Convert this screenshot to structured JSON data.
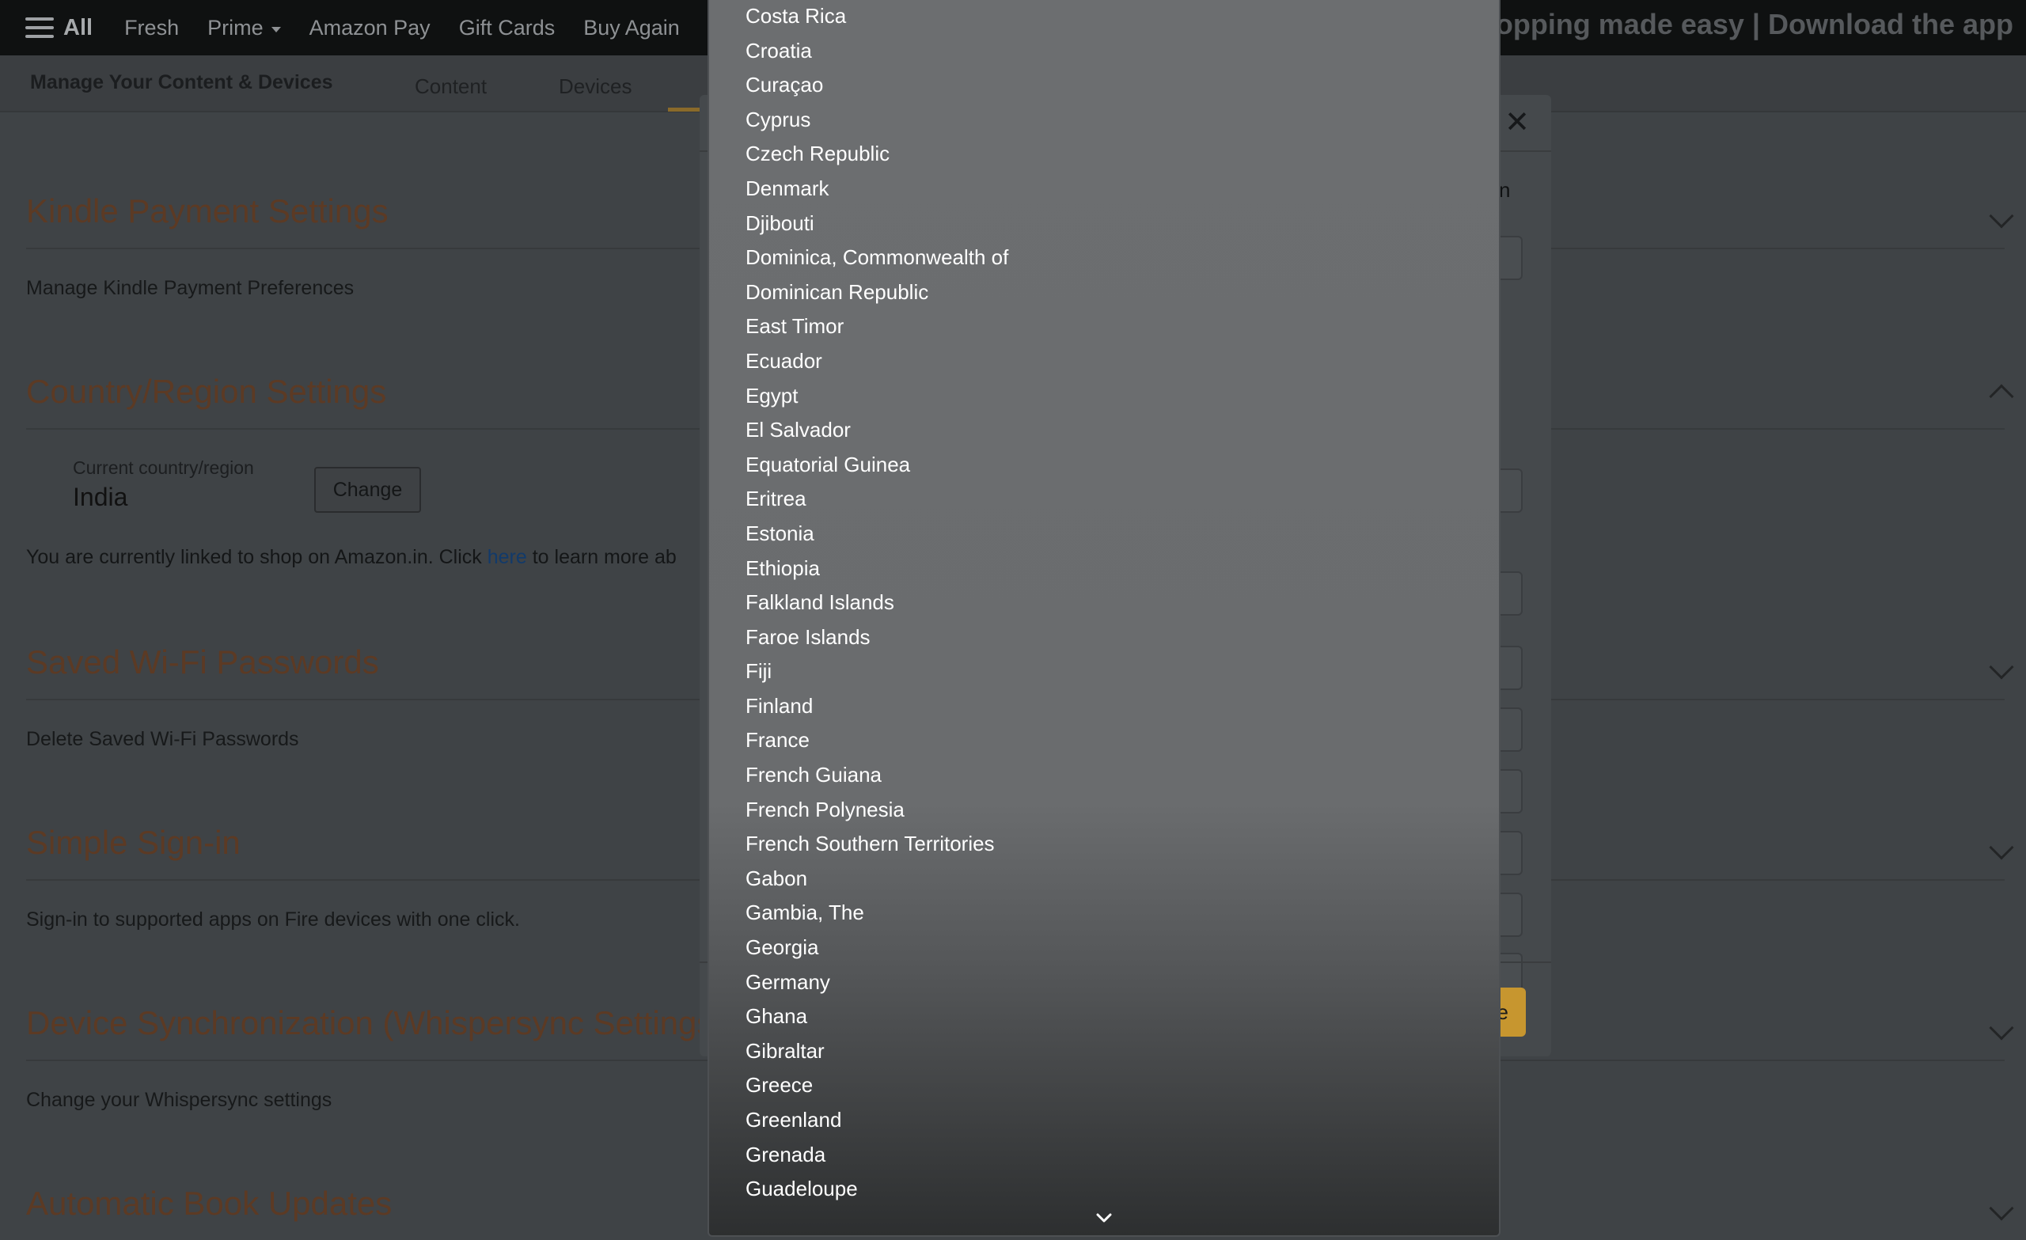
{
  "nav": {
    "all_label": "All",
    "items": [
      "Fresh",
      "Prime",
      "Amazon Pay",
      "Gift Cards",
      "Buy Again"
    ],
    "promo": "Shopping made easy | Download the app"
  },
  "subnav": {
    "title": "Manage Your Content & Devices",
    "tabs": [
      "Content",
      "Devices"
    ]
  },
  "sections": [
    {
      "title": "Kindle Payment Settings",
      "subtitle": "Manage Kindle Payment Preferences"
    },
    {
      "title": "Country/Region Settings",
      "subtitle": ""
    },
    {
      "title": "Saved Wi-Fi Passwords",
      "subtitle": "Delete Saved Wi-Fi Passwords"
    },
    {
      "title": "Simple Sign-in",
      "subtitle": "Sign-in to supported apps on Fire devices with one click."
    },
    {
      "title": "Device Synchronization (Whispersync Settings)",
      "subtitle": "Change your Whispersync settings"
    },
    {
      "title": "Automatic Book Updates",
      "subtitle": ""
    }
  ],
  "country": {
    "current_label": "Current country/region",
    "current_value": "India",
    "change_button": "Change",
    "linked_prefix": "You are currently linked to shop on Amazon.in. Click ",
    "linked_link": "here",
    "linked_suffix": " to learn more ab"
  },
  "modal": {
    "close_glyph": "✕",
    "header_fragment": "n",
    "primary_fragment": "e"
  },
  "dropdown": {
    "options": [
      "Costa Rica",
      "Croatia",
      "Curaçao",
      "Cyprus",
      "Czech Republic",
      "Denmark",
      "Djibouti",
      "Dominica, Commonwealth of",
      "Dominican Republic",
      "East Timor",
      "Ecuador",
      "Egypt",
      "El Salvador",
      "Equatorial Guinea",
      "Eritrea",
      "Estonia",
      "Ethiopia",
      "Falkland Islands",
      "Faroe Islands",
      "Fiji",
      "Finland",
      "France",
      "French Guiana",
      "French Polynesia",
      "French Southern Territories",
      "Gabon",
      "Gambia, The",
      "Georgia",
      "Germany",
      "Ghana",
      "Gibraltar",
      "Greece",
      "Greenland",
      "Grenada",
      "Guadeloupe"
    ],
    "scroll_icon": "chevron-down-icon"
  }
}
